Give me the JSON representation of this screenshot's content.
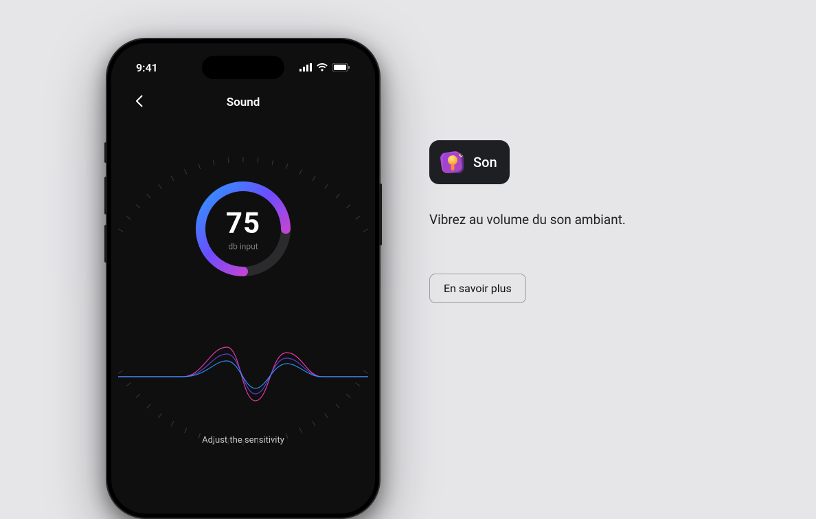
{
  "status_bar": {
    "time": "9:41"
  },
  "header": {
    "title": "Sound"
  },
  "gauge": {
    "value": "75",
    "label": "db input",
    "percent": 0.75,
    "colors": {
      "start": "#2b9bff",
      "mid": "#6b4dff",
      "end": "#ff3fb4"
    }
  },
  "waveform": {
    "colors": {
      "a": "#ff3fb4",
      "b": "#6b4dff",
      "c": "#2b9bff"
    }
  },
  "sensitivity": {
    "label": "Adjust the sensitivity"
  },
  "feature": {
    "badge_label": "Son",
    "description": "Vibrez au volume du son ambiant.",
    "button": "En savoir plus",
    "icon_name": "microphone-icon"
  }
}
